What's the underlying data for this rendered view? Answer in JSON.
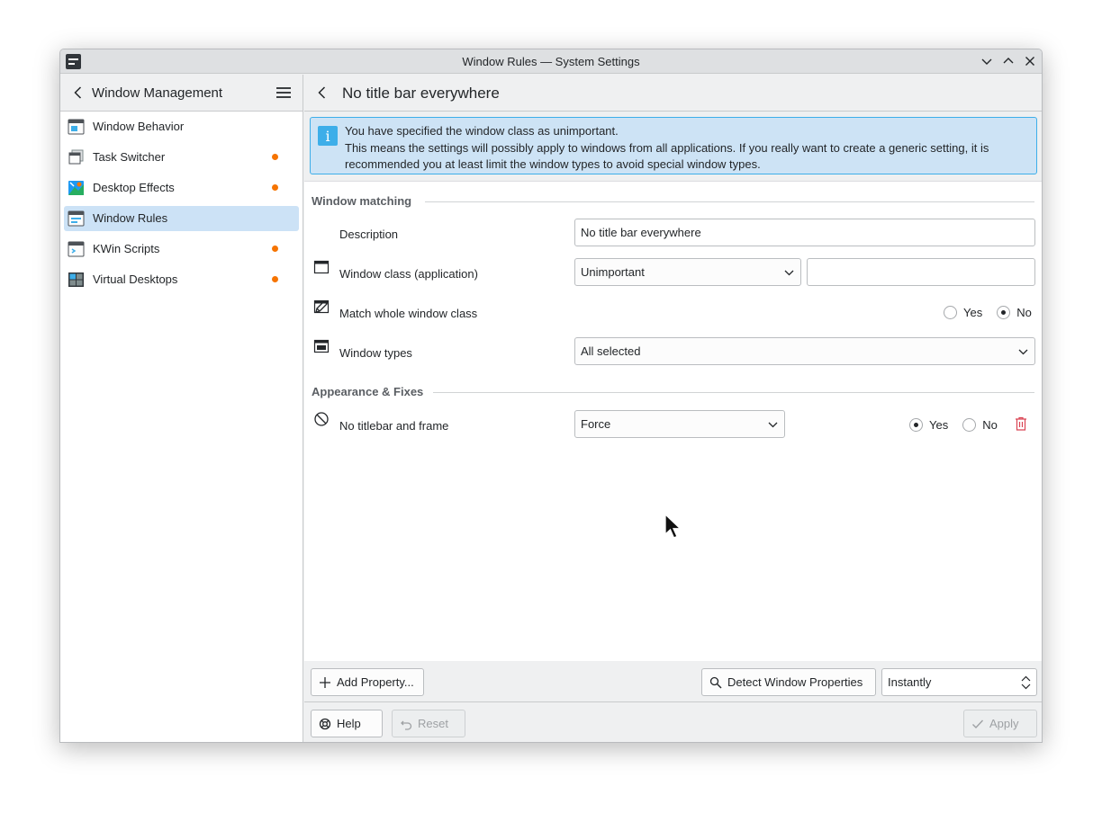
{
  "window": {
    "title": "Window Rules — System Settings"
  },
  "sidebar": {
    "title": "Window Management",
    "items": [
      {
        "label": "Window Behavior",
        "icon": "window-behavior-icon",
        "dot": false,
        "active": false
      },
      {
        "label": "Task Switcher",
        "icon": "task-switcher-icon",
        "dot": true,
        "active": false
      },
      {
        "label": "Desktop Effects",
        "icon": "desktop-effects-icon",
        "dot": true,
        "active": false
      },
      {
        "label": "Window Rules",
        "icon": "window-rules-icon",
        "dot": true,
        "active": true
      },
      {
        "label": "KWin Scripts",
        "icon": "kwin-scripts-icon",
        "dot": true,
        "active": false
      },
      {
        "label": "Virtual Desktops",
        "icon": "virtual-desktops-icon",
        "dot": true,
        "active": false
      }
    ]
  },
  "main": {
    "title": "No title bar everywhere",
    "banner": {
      "line1": "You have specified the window class as unimportant.",
      "line2": "This means the settings will possibly apply to windows from all applications. If you really want to create a generic setting, it is recommended you at least limit the window types to avoid special window types."
    },
    "window_matching": {
      "heading": "Window matching",
      "description": {
        "label": "Description",
        "value": "No title bar everywhere"
      },
      "window_class": {
        "label": "Window class (application)",
        "selected": "Unimportant",
        "value": ""
      },
      "match_whole": {
        "label": "Match whole window class",
        "yes": "Yes",
        "no": "No",
        "selected": "No"
      },
      "window_types": {
        "label": "Window types",
        "selected": "All selected"
      }
    },
    "appearance": {
      "heading": "Appearance & Fixes",
      "no_titlebar": {
        "label": "No titlebar and frame",
        "selected": "Force",
        "yes": "Yes",
        "no": "No",
        "value": "Yes"
      }
    },
    "bottom": {
      "add_property": "Add Property...",
      "detect": "Detect Window Properties",
      "delay": "Instantly"
    },
    "footer": {
      "help": "Help",
      "reset": "Reset",
      "apply": "Apply"
    }
  },
  "colors": {
    "accent": "#3daee9",
    "selection": "#cce2f6",
    "dot": "#f67400",
    "delete": "#da4453"
  }
}
